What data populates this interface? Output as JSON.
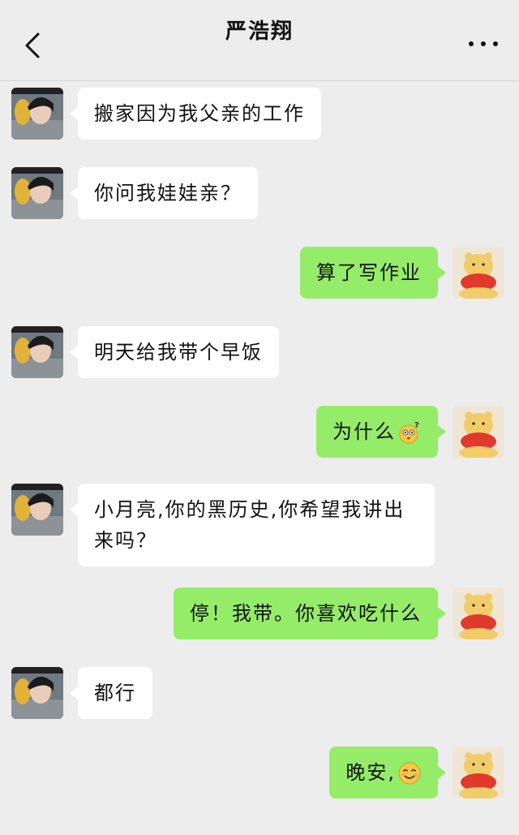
{
  "header": {
    "title": "严浩翔"
  },
  "messages": [
    {
      "side": "left",
      "text": "搬家因为我父亲的工作"
    },
    {
      "side": "left",
      "text": "你问我娃娃亲？"
    },
    {
      "side": "right",
      "text": "算了写作业"
    },
    {
      "side": "left",
      "text": "明天给我带个早饭"
    },
    {
      "side": "right",
      "text": "为什么",
      "emoji": "confused-face-emoji"
    },
    {
      "side": "left",
      "text": "小月亮,你的黑历史,你希望我讲出来吗？"
    },
    {
      "side": "right",
      "text": "停！我带。你喜欢吃什么"
    },
    {
      "side": "left",
      "text": "都行"
    },
    {
      "side": "right",
      "text": "晚安,",
      "emoji": "smile-emoji"
    }
  ],
  "colors": {
    "background": "#ededed",
    "sent_bubble": "#95ec69",
    "received_bubble": "#ffffff"
  },
  "icons": {
    "back": "back-arrow-icon",
    "more": "more-options-icon"
  }
}
